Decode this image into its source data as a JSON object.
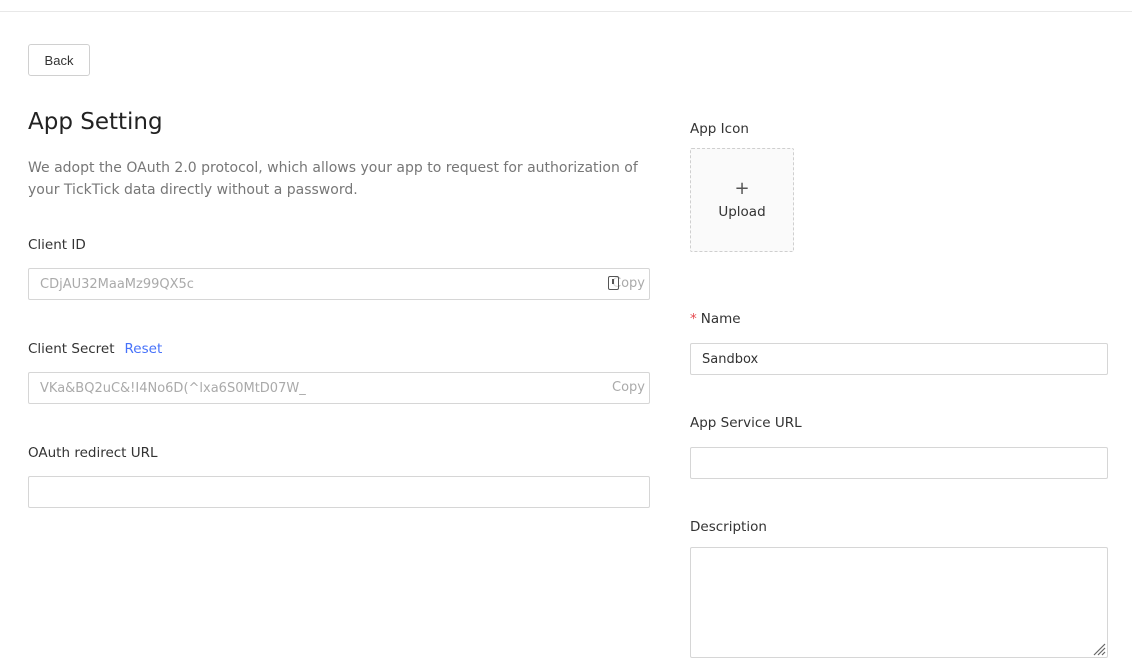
{
  "toolbar": {
    "back_label": "Back"
  },
  "page": {
    "title": "App Setting",
    "intro": "We adopt the OAuth 2.0 protocol, which allows your app to request for authorization of your TickTick data directly without a password."
  },
  "client_id": {
    "label": "Client ID",
    "value": "CDjAU32MaaMz99QX5c",
    "copy_label": "Copy"
  },
  "client_secret": {
    "label": "Client Secret",
    "reset_label": "Reset",
    "value": "VKa&BQ2uC&!I4No6D(^lxa6S0MtD07W_",
    "copy_label": "Copy"
  },
  "redirect_url": {
    "label": "OAuth redirect URL",
    "value": ""
  },
  "app_icon": {
    "label": "App Icon",
    "plus": "+",
    "upload_label": "Upload"
  },
  "name": {
    "required_mark": "*",
    "label": "Name",
    "value": "Sandbox"
  },
  "service_url": {
    "label": "App Service URL",
    "value": ""
  },
  "description": {
    "label": "Description",
    "value": ""
  },
  "colors": {
    "accent": "#4772fa",
    "required": "#e5484d",
    "border": "#d6d6d6",
    "muted_text": "#777777"
  }
}
